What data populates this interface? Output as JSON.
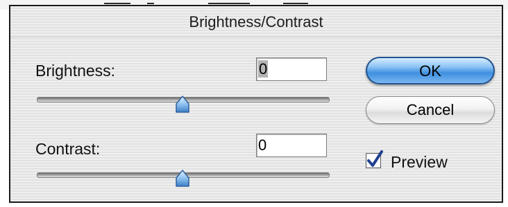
{
  "dialog": {
    "title": "Brightness/Contrast",
    "brightness": {
      "label": "Brightness:",
      "value": "0",
      "slider_level": 0.5
    },
    "contrast": {
      "label": "Contrast:",
      "value": "0",
      "slider_level": 0.5
    },
    "buttons": {
      "ok_label": "OK",
      "cancel_label": "Cancel"
    },
    "preview": {
      "label": "Preview",
      "checked": true
    }
  },
  "colors": {
    "accent_button": "#3f8fe0",
    "slider_thumb": "#6aaae8",
    "checkmark": "#1f3f8f"
  },
  "icons": {
    "slider_thumb": "slider-thumb-icon",
    "checkmark": "checkmark-icon"
  }
}
